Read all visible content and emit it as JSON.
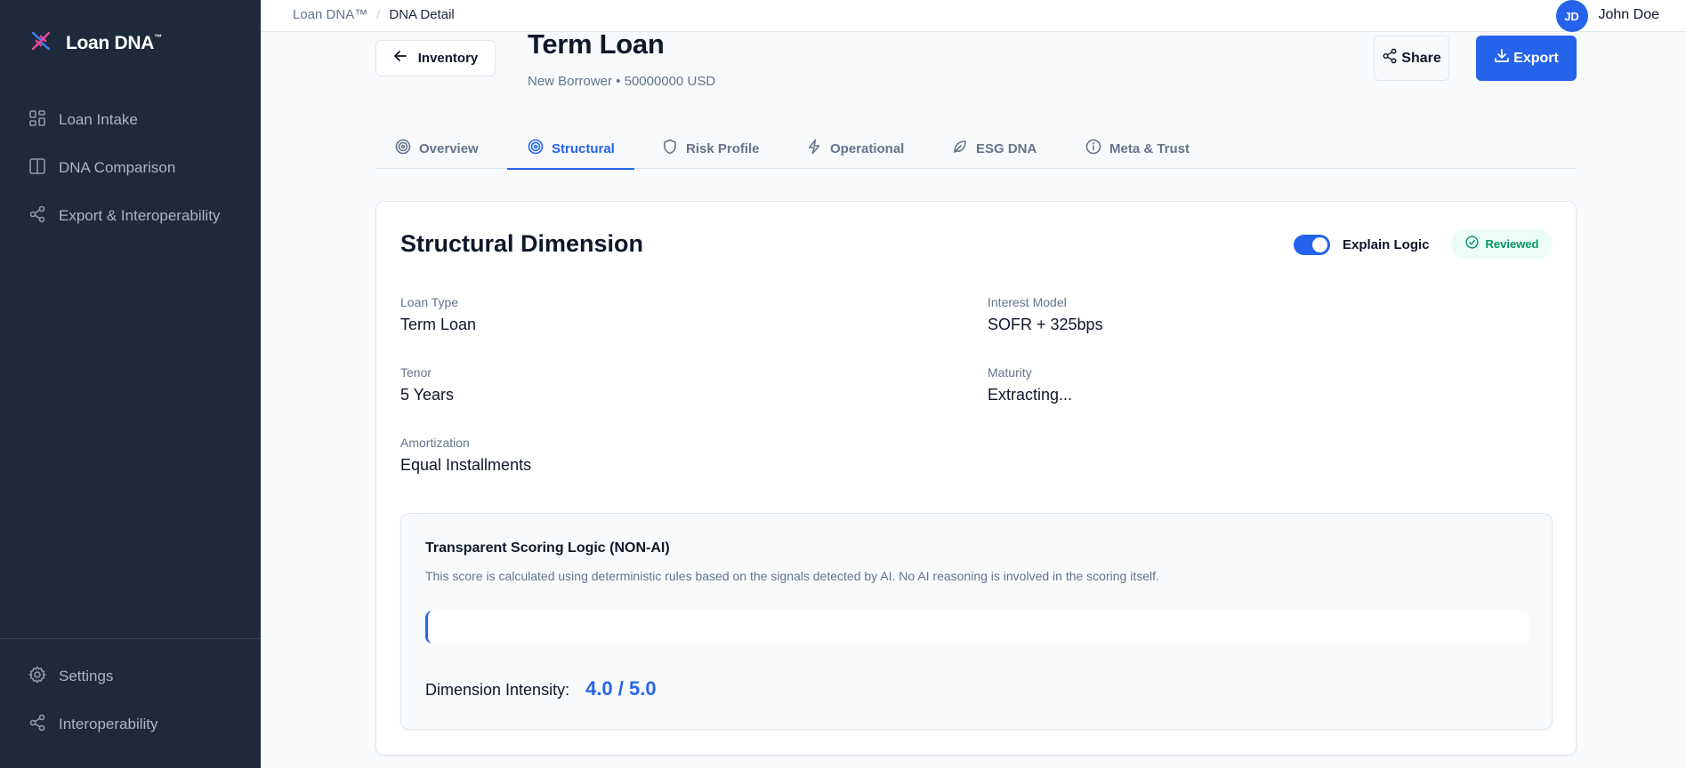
{
  "app": {
    "name": "Loan DNA",
    "trademark": "™"
  },
  "sidebar": {
    "items": [
      {
        "label": "Loan Intake",
        "icon": "grid-icon"
      },
      {
        "label": "DNA Comparison",
        "icon": "columns-icon"
      },
      {
        "label": "Export & Interoperability",
        "icon": "share-icon"
      }
    ],
    "bottom_items": [
      {
        "label": "Settings",
        "icon": "gear-icon"
      },
      {
        "label": "Interoperability",
        "icon": "share-icon"
      }
    ]
  },
  "breadcrumb": {
    "root": "Loan DNA™",
    "separator": "/",
    "current": "DNA Detail"
  },
  "user": {
    "initials": "JD",
    "name": "John Doe"
  },
  "header": {
    "back_label": "Inventory",
    "title": "Term Loan",
    "subtitle": "New Borrower • 50000000 USD",
    "share_label": "Share",
    "export_label": "Export"
  },
  "tabs": [
    {
      "label": "Overview",
      "icon": "target-icon",
      "active": false
    },
    {
      "label": "Structural",
      "icon": "target-icon",
      "active": true
    },
    {
      "label": "Risk Profile",
      "icon": "shield-icon",
      "active": false
    },
    {
      "label": "Operational",
      "icon": "bolt-icon",
      "active": false
    },
    {
      "label": "ESG DNA",
      "icon": "leaf-icon",
      "active": false
    },
    {
      "label": "Meta & Trust",
      "icon": "info-icon",
      "active": false
    }
  ],
  "card": {
    "title": "Structural Dimension",
    "toggle_label": "Explain Logic",
    "toggle_on": true,
    "badge": "Reviewed",
    "fields": {
      "loan_type": {
        "label": "Loan Type",
        "value": "Term Loan"
      },
      "interest_model": {
        "label": "Interest Model",
        "value": "SOFR + 325bps"
      },
      "tenor": {
        "label": "Tenor",
        "value": "5 Years"
      },
      "maturity": {
        "label": "Maturity",
        "value": "Extracting..."
      },
      "amortization": {
        "label": "Amortization",
        "value": "Equal Installments"
      }
    },
    "logic": {
      "title": "Transparent Scoring Logic (NON-AI)",
      "description": "This score is calculated using deterministic rules based on the signals detected by AI. No AI reasoning is involved in the scoring itself.",
      "intensity_label": "Dimension Intensity:",
      "intensity_value": "4.0 / 5.0"
    }
  },
  "colors": {
    "sidebar_bg": "#1e293b",
    "accent": "#2563eb",
    "success": "#059669",
    "page_bg": "#f8fafc"
  }
}
